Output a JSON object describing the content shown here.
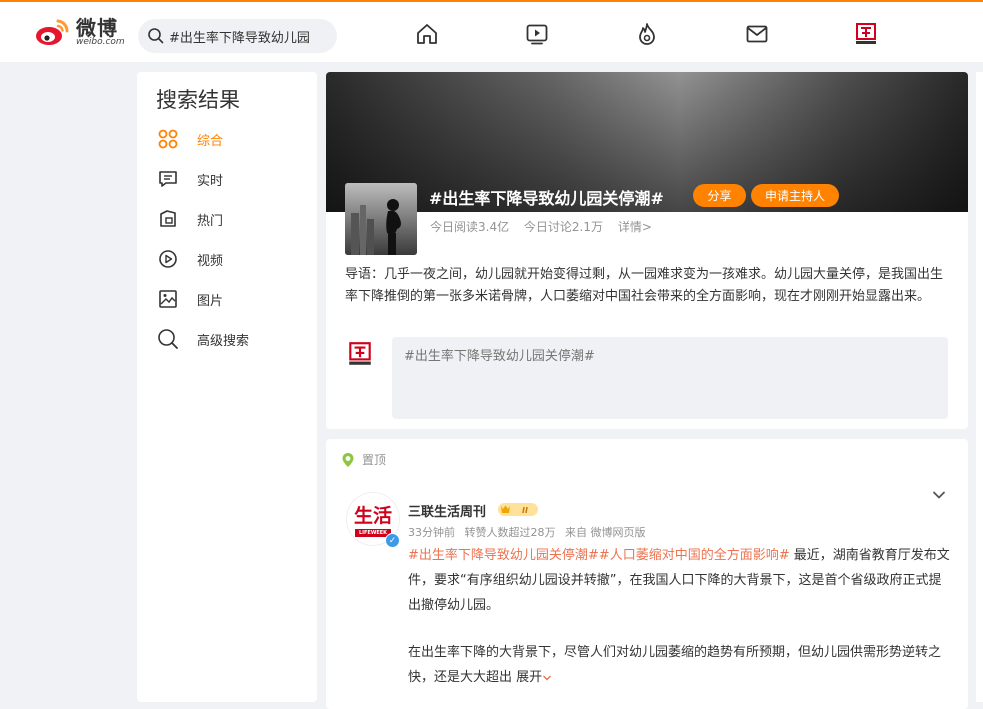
{
  "header": {
    "logo_cn": "微博",
    "logo_en": "weibo.com",
    "search_value": "#出生率下降导致幼儿园",
    "nav_icons": [
      "home-icon",
      "video-icon",
      "hot-icon",
      "message-icon",
      "profile-avatar"
    ]
  },
  "sidebar": {
    "title": "搜索结果",
    "items": [
      {
        "label": "综合",
        "icon": "grid-icon",
        "active": true
      },
      {
        "label": "实时",
        "icon": "chat-icon"
      },
      {
        "label": "热门",
        "icon": "hot-doc-icon"
      },
      {
        "label": "视频",
        "icon": "play-icon"
      },
      {
        "label": "图片",
        "icon": "image-icon"
      },
      {
        "label": "高级搜索",
        "icon": "search-icon"
      }
    ]
  },
  "topic": {
    "title": "#出生率下降导致幼儿园关停潮#",
    "share_label": "分享",
    "host_label": "申请主持人",
    "reads": "今日阅读3.4亿",
    "discussions": "今日讨论2.1万",
    "details": "详情>",
    "intro": "导语：几乎一夜之间，幼儿园就开始变得过剩，从一园难求变为一孩难求。幼儿园大量关停，是我国出生率下降推倒的第一张多米诺骨牌，人口萎缩对中国社会带来的全方面影响，现在才刚刚开始显露出来。",
    "composer_placeholder": "#出生率下降导致幼儿园关停潮#"
  },
  "post": {
    "pinned_label": "置顶",
    "author": "三联生活周刊",
    "meta_time": "33分钟前",
    "meta_reposts": "转赞人数超过28万",
    "meta_source": "来自 微博网页版",
    "tag1": "#出生率下降导致幼儿园关停潮#",
    "tag2": "#人口萎缩对中国的全方面影响#",
    "text1": " 最近，湖南省教育厅发布文件，要求“有序组织幼儿园设并转撤”，在我国人口下降的大背景下，这是首个省级政府正式提出撤停幼儿园。",
    "text2": "在出生率下降的大背景下，尽管人们对幼儿园萎缩的趋势有所预期，但幼儿园供需形势逆转之快，还是大大超出",
    "expand_label": "展开",
    "avatar_text": "生活",
    "avatar_sub": "LIFEWEEK"
  },
  "colors": {
    "accent": "#ff8200",
    "tag": "#eb7350",
    "muted": "#939393"
  }
}
